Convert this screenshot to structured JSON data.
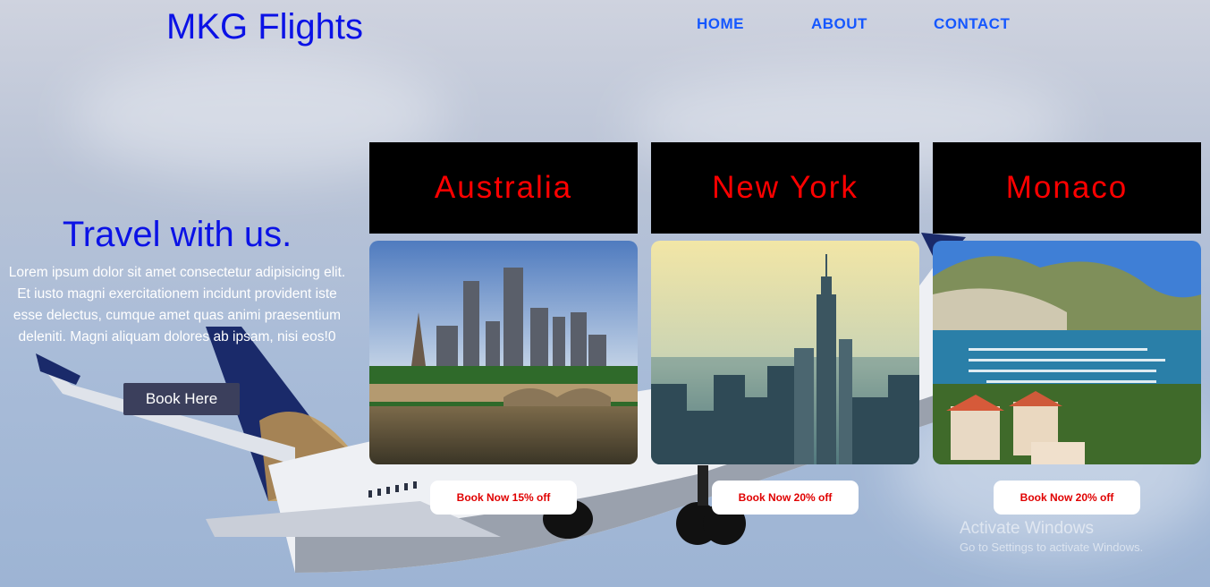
{
  "header": {
    "brand": "MKG Flights",
    "nav": {
      "home": "HOME",
      "about": "ABOUT",
      "contact": "CONTACT"
    }
  },
  "hero": {
    "heading": "Travel with us.",
    "body": "Lorem ipsum dolor sit amet consectetur adipisicing elit. Et iusto magni exercitationem incidunt provident iste esse delectus, cumque amet quas animi praesentium deleniti. Magni aliquam dolores ab ipsam, nisi eos!0",
    "button": "Book Here"
  },
  "destinations": [
    {
      "name": "Australia",
      "offer": "Book Now 15% off"
    },
    {
      "name": "New York",
      "offer": "Book Now 20% off"
    },
    {
      "name": "Monaco",
      "offer": "Book Now 20% off"
    }
  ],
  "watermark": {
    "line1": "Activate Windows",
    "line2": "Go to Settings to activate Windows."
  },
  "colors": {
    "brand": "#0b12e6",
    "nav": "#1557ff",
    "card_title": "#ff0000",
    "offer_text": "#e00000",
    "button_bg": "#3b3f5c"
  }
}
